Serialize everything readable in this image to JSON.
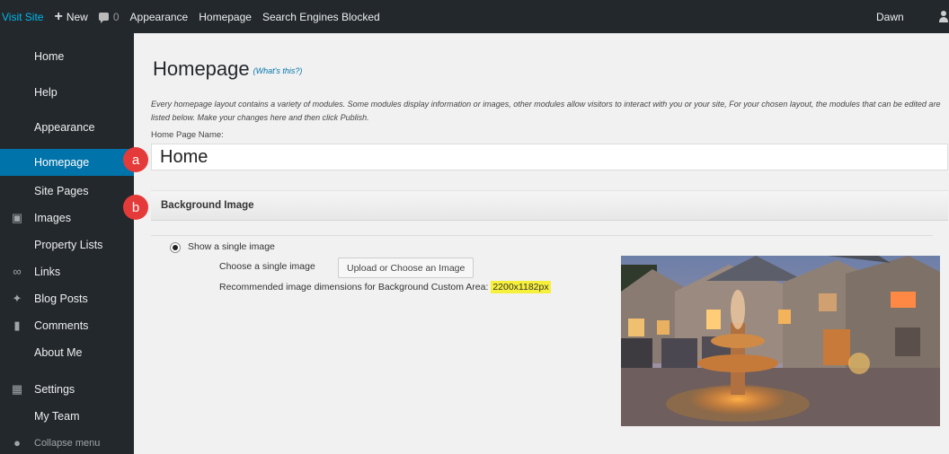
{
  "adminbar": {
    "visit_site": "Visit Site",
    "new_label": "New",
    "comment_count": "0",
    "appearance": "Appearance",
    "homepage": "Homepage",
    "search_engines": "Search Engines Blocked",
    "user": "Dawn"
  },
  "sidebar": {
    "items": [
      {
        "label": "Home",
        "icon": ""
      },
      {
        "label": "Help",
        "icon": ""
      },
      {
        "label": "Appearance",
        "icon": ""
      },
      {
        "label": "Homepage",
        "icon": "",
        "active": true
      },
      {
        "label": "Site Pages",
        "icon": ""
      },
      {
        "label": "Images",
        "icon": "images-icon"
      },
      {
        "label": "Property Lists",
        "icon": ""
      },
      {
        "label": "Links",
        "icon": "link-icon"
      },
      {
        "label": "Blog Posts",
        "icon": "pin-icon"
      },
      {
        "label": "Comments",
        "icon": "comment-icon"
      },
      {
        "label": "About Me",
        "icon": ""
      },
      {
        "label": "Settings",
        "icon": "settings-icon"
      },
      {
        "label": "My Team",
        "icon": ""
      }
    ],
    "collapse": "Collapse menu"
  },
  "main": {
    "title": "Homepage",
    "whats_this": "(What's this?)",
    "description": "Every homepage layout contains a variety of modules. Some modules display information or images, other modules allow visitors to interact with you or your site, For your chosen layout, the modules that can be edited are listed below. Make your changes here and then click Publish.",
    "home_page_name_label": "Home Page Name:",
    "home_page_name_value": "Home",
    "section_title": "Background Image",
    "radio_label": "Show a single image",
    "choose_label": "Choose a single image",
    "upload_button": "Upload or Choose an Image",
    "recommended_text": "Recommended image dimensions for Background Custom Area:",
    "recommended_dims": "2200x1182px"
  },
  "callouts": {
    "a": "a",
    "b": "b"
  },
  "colors": {
    "adminbar": "#23282d",
    "active": "#0073aa",
    "callout": "#e53a3a",
    "highlight": "#f7f03a"
  }
}
